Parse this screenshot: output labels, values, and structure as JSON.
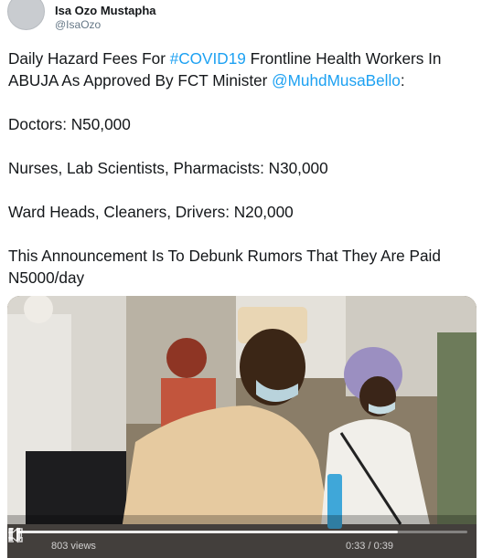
{
  "author": {
    "name": "Isa Ozo Mustapha",
    "handle": "@IsaOzo"
  },
  "tweet": {
    "line1_prefix": "Daily Hazard Fees For ",
    "line1_hashtag": "#COVID19",
    "line1_suffix": " Frontline Health Workers In",
    "line2_prefix": "ABUJA As Approved By FCT Minister ",
    "line2_mention": "@MuhdMusaBello",
    "line2_suffix": ":",
    "doctors": "Doctors: N50,000",
    "nurses": "Nurses, Lab Scientists, Pharmacists: N30,000",
    "ward": "Ward Heads, Cleaners, Drivers: N20,000",
    "announce1": "This Announcement Is To Debunk Rumors That They Are Paid",
    "announce2": "N5000/day"
  },
  "video": {
    "views": "803 views",
    "time": "0:33 / 0:39",
    "progress_fraction": 0.846
  },
  "colors": {
    "link": "#1da1f2",
    "text": "#14171a",
    "muted": "#657786"
  },
  "icons": {
    "pause": "pause-icon",
    "volume": "volume-icon",
    "fullscreen": "fullscreen-icon"
  }
}
